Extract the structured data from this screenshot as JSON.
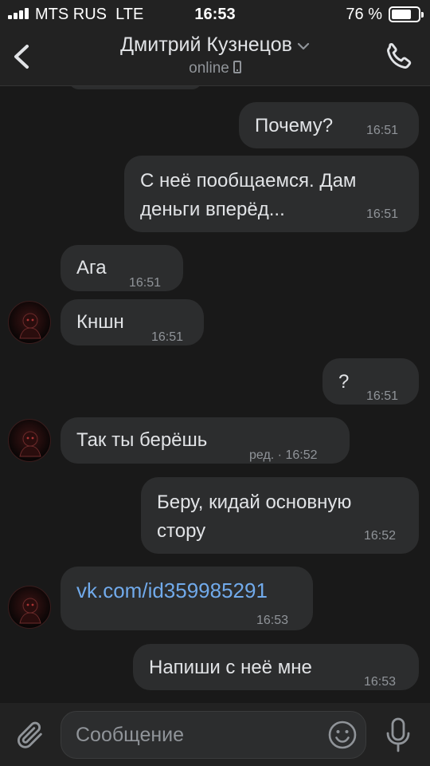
{
  "status_bar": {
    "carrier": "MTS RUS",
    "network": "LTE",
    "time": "16:53",
    "battery": "76 %",
    "battery_level": 0.76
  },
  "header": {
    "contact_name": "Дмитрий Кузнецов",
    "presence": "online",
    "icons": [
      "back-icon",
      "chevron-down-icon",
      "mobile-phone-icon",
      "phone-call-icon"
    ]
  },
  "messages": [
    {
      "direction": "outgoing",
      "lines": [
        "Почему?"
      ],
      "time": "16:51"
    },
    {
      "direction": "outgoing",
      "lines": [
        "С неё пообщаемся. Дам",
        "деньги вперёд..."
      ],
      "time": "16:51"
    },
    {
      "direction": "incoming",
      "lines": [
        "Ага"
      ],
      "time": "16:51"
    },
    {
      "direction": "incoming",
      "lines": [
        "Кншн"
      ],
      "time": "16:51"
    },
    {
      "direction": "outgoing",
      "lines": [
        "?"
      ],
      "time": "16:51"
    },
    {
      "direction": "incoming",
      "lines": [
        "Так ты берёшь"
      ],
      "time": "ред. · 16:52"
    },
    {
      "direction": "outgoing",
      "lines": [
        "Беру, кидай основную",
        "стору"
      ],
      "time": "16:52"
    },
    {
      "direction": "incoming",
      "lines": [
        "vk.com/id359985291"
      ],
      "time": "16:53",
      "is_link": true
    },
    {
      "direction": "outgoing",
      "lines": [
        "Напиши с неё мне"
      ],
      "time": "16:53"
    }
  ],
  "composer": {
    "placeholder": "Сообщение",
    "icons": [
      "paperclip-icon",
      "emoji-icon",
      "microphone-icon"
    ]
  },
  "colors": {
    "background": "#191919",
    "bar": "#222222",
    "bubble": "#2c2d2e",
    "text": "#e1e3e6",
    "secondary": "#909499",
    "link": "#71aaeb"
  }
}
